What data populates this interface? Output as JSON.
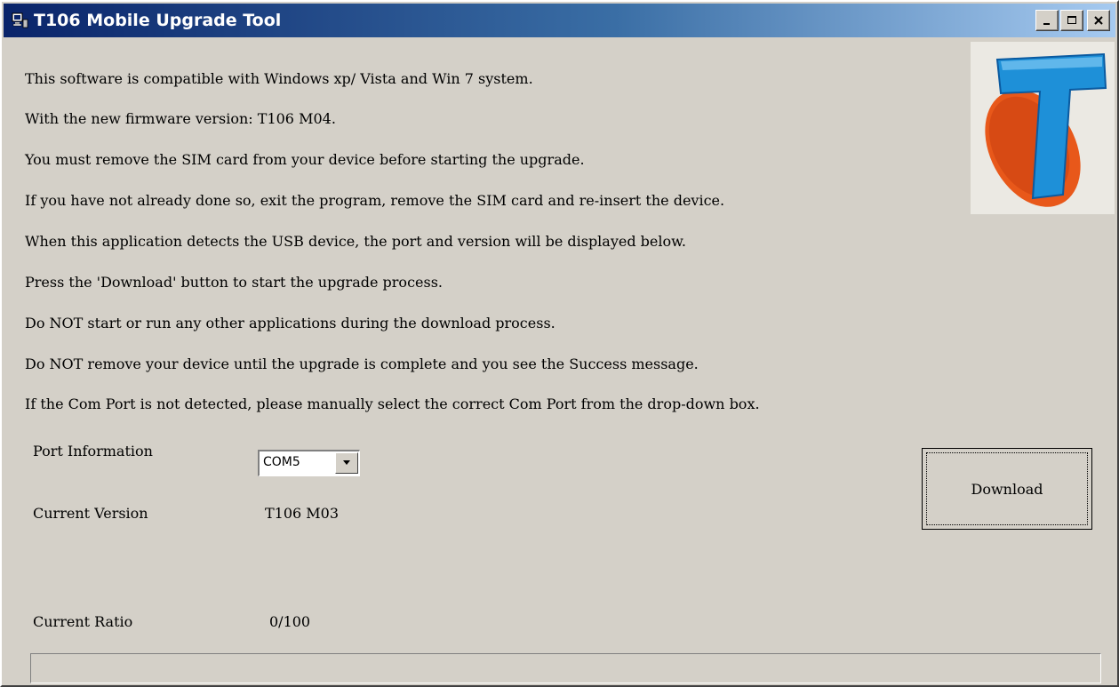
{
  "window": {
    "title": "T106 Mobile Upgrade Tool",
    "minimize": "_",
    "maximize": "□",
    "close": "X"
  },
  "info_lines": [
    "This software is compatible with Windows xp/ Vista and Win 7 system.",
    "With the new firmware version: T106 M04.",
    "You must remove the SIM card from your device before starting the upgrade.",
    "If you have not already done so, exit the program, remove the SIM card and re-insert the device.",
    "When this application detects the USB device, the port and version will be displayed below.",
    "Press the 'Download' button to start the upgrade process.",
    "Do NOT start or run any other applications during the download process.",
    "Do NOT remove your device until the upgrade is complete and you see the Success message.",
    "If the Com Port is not detected, please manually select the correct Com Port from the drop-down box."
  ],
  "port": {
    "label": "Port Information",
    "selected": "COM5"
  },
  "version": {
    "label": "Current Version",
    "value": "T106 M03"
  },
  "ratio": {
    "label": "Current Ratio",
    "value": "0/100"
  },
  "download_button": "Download",
  "progress": {
    "fraction": 0
  },
  "logo": {
    "icon": "telstra-t-logo",
    "colors": {
      "t_blue": "#1e90d8",
      "oval_orange": "#e8581a"
    }
  }
}
